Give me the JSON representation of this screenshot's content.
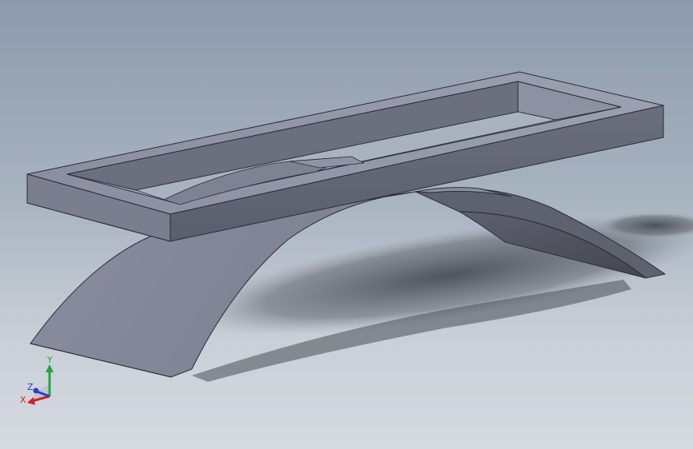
{
  "viewport": {
    "background_top": "#8c9aab",
    "background_bottom": "#d6dbe1"
  },
  "model": {
    "face_color": "#6e7281",
    "top_face_color": "#9a9fb0",
    "dark_face_color": "#585b68",
    "edge_color": "#2a2c33"
  },
  "triad": {
    "x_label": "X",
    "y_label": "Y",
    "z_label": "Z",
    "x_color": "#d0202a",
    "y_color": "#1fa83a",
    "z_color": "#2a3fc0"
  }
}
